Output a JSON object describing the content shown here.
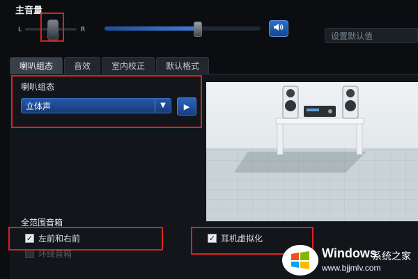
{
  "header": {
    "title": "主音量",
    "left_label": "L",
    "right_label": "R",
    "set_default_placeholder": "设置默认值"
  },
  "volume": {
    "balance": 0.55,
    "level": 0.59
  },
  "tabs": [
    {
      "label": "喇叭组态",
      "active": true
    },
    {
      "label": "音效",
      "active": false
    },
    {
      "label": "室内校正",
      "active": false
    },
    {
      "label": "默认格式",
      "active": false
    }
  ],
  "speaker_config": {
    "group_label": "喇叭组态",
    "selected": "立体声"
  },
  "full_range": {
    "section_label": "全范围音箱",
    "front_left_right": {
      "label": "左前和右前",
      "checked": true
    },
    "surround": {
      "label": "环绕音箱",
      "checked": false,
      "disabled": true
    }
  },
  "headphone_virtualization": {
    "label": "耳机虚拟化",
    "checked": true
  },
  "watermark": {
    "brand": "Windows",
    "suffix": "系统之家",
    "url": "www.bjjmlv.com"
  },
  "colors": {
    "highlight": "#e0201c",
    "accent": "#2558a8"
  },
  "icons": {
    "mute": "speaker-icon",
    "dropdown": "chevron-down-icon",
    "play": "play-icon"
  }
}
